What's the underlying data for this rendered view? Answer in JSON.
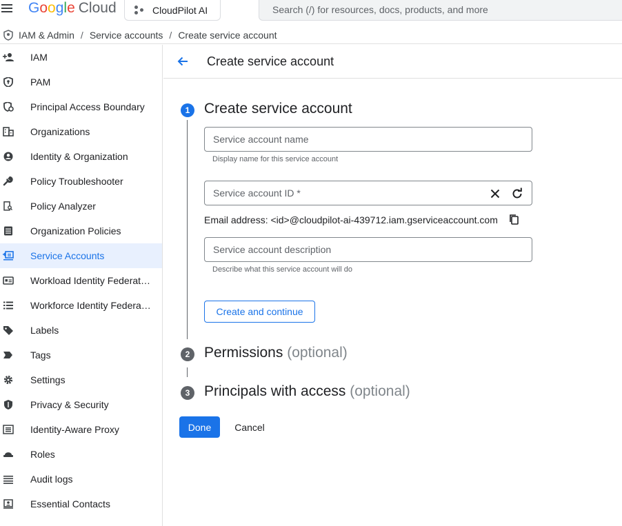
{
  "header": {
    "logo_google": [
      "G",
      "o",
      "o",
      "g",
      "l",
      "e"
    ],
    "logo_cloud": "Cloud",
    "project_name": "CloudPilot AI",
    "search_placeholder": "Search (/) for resources, docs, products, and more"
  },
  "breadcrumb": {
    "items": [
      "IAM & Admin",
      "Service accounts",
      "Create service account"
    ],
    "separator": "/"
  },
  "sidebar": {
    "items": [
      {
        "label": "IAM",
        "icon": "person-add-icon"
      },
      {
        "label": "PAM",
        "icon": "shield-key-icon"
      },
      {
        "label": "Principal Access Boundary",
        "icon": "policy-boundary-icon"
      },
      {
        "label": "Organizations",
        "icon": "building-icon"
      },
      {
        "label": "Identity & Organization",
        "icon": "account-circle-icon"
      },
      {
        "label": "Policy Troubleshooter",
        "icon": "wrench-icon"
      },
      {
        "label": "Policy Analyzer",
        "icon": "document-search-icon"
      },
      {
        "label": "Organization Policies",
        "icon": "list-document-icon"
      },
      {
        "label": "Service Accounts",
        "icon": "service-account-icon",
        "active": true
      },
      {
        "label": "Workload Identity Federat…",
        "icon": "id-card-icon"
      },
      {
        "label": "Workforce Identity Federa…",
        "icon": "list-icon"
      },
      {
        "label": "Labels",
        "icon": "label-icon"
      },
      {
        "label": "Tags",
        "icon": "tag-arrow-icon"
      },
      {
        "label": "Settings",
        "icon": "gear-icon"
      },
      {
        "label": "Privacy & Security",
        "icon": "shield-icon"
      },
      {
        "label": "Identity-Aware Proxy",
        "icon": "proxy-icon"
      },
      {
        "label": "Roles",
        "icon": "hat-icon"
      },
      {
        "label": "Audit logs",
        "icon": "lines-icon"
      },
      {
        "label": "Essential Contacts",
        "icon": "contact-card-icon"
      }
    ]
  },
  "page": {
    "title": "Create service account"
  },
  "steps": [
    {
      "number": "1",
      "title": "Create service account",
      "optional": ""
    },
    {
      "number": "2",
      "title": "Permissions",
      "optional": "(optional)"
    },
    {
      "number": "3",
      "title": "Principals with access",
      "optional": "(optional)"
    }
  ],
  "form": {
    "name_placeholder": "Service account name",
    "name_hint": "Display name for this service account",
    "id_placeholder": "Service account ID *",
    "email_text": "Email address: <id>@cloudpilot-ai-439712.iam.gserviceaccount.com",
    "description_placeholder": "Service account description",
    "description_hint": "Describe what this service account will do",
    "create_button": "Create and continue"
  },
  "actions": {
    "done": "Done",
    "cancel": "Cancel"
  },
  "colors": {
    "accent": "#1a73e8",
    "active_bg": "#e8f0fe",
    "step_active": "#1a73e8",
    "step_inactive": "#5f6368"
  }
}
